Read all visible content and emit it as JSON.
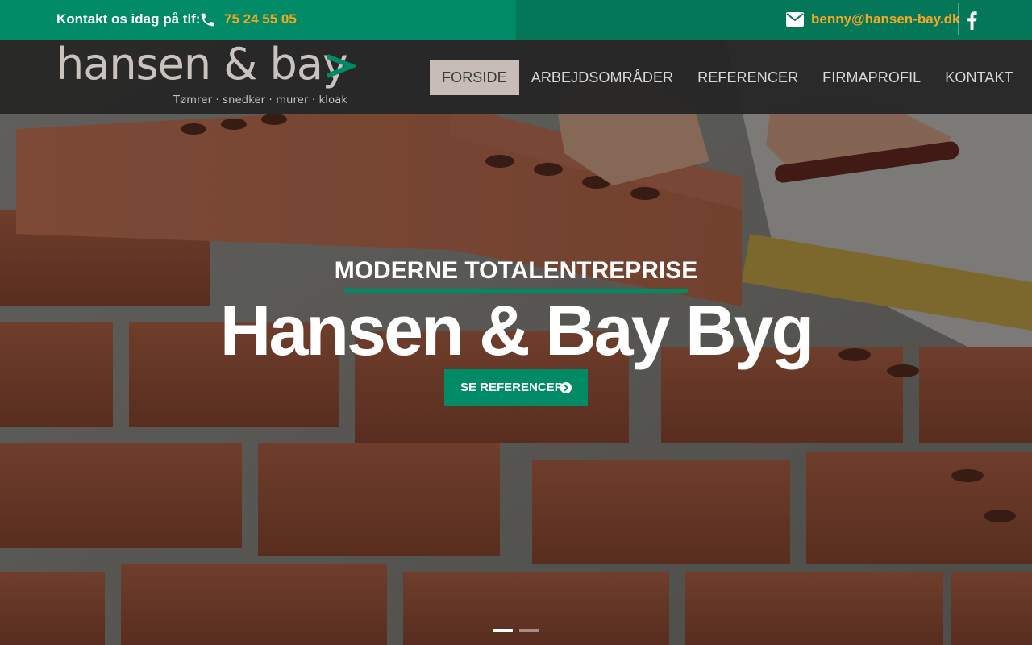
{
  "topbar": {
    "contact_label": "Kontakt os idag på tlf:",
    "phone": "75 24 55 05",
    "email": "benny@hansen-bay.dk",
    "icons": {
      "phone": "phone-icon",
      "mail": "envelope-icon",
      "social": "facebook-icon"
    }
  },
  "logo": {
    "wordmark": "hansen & bay",
    "tagline": "Tømrer · snedker · murer · kloak"
  },
  "nav": {
    "items": [
      {
        "label": "FORSIDE",
        "active": true
      },
      {
        "label": "ARBEJDSOMRÅDER",
        "active": false
      },
      {
        "label": "REFERENCER",
        "active": false
      },
      {
        "label": "FIRMAPROFIL",
        "active": false
      },
      {
        "label": "KONTAKT",
        "active": false
      }
    ]
  },
  "hero": {
    "subtitle": "MODERNE TOTALENTREPRISE",
    "title": "Hansen & Bay Byg",
    "button_label": "SE REFERENCER",
    "button_icon": "chevron-circle-right-icon",
    "slides": {
      "total": 2,
      "active": 1
    }
  },
  "colors": {
    "brand_green": "#018a66",
    "brand_green_dark": "#037758",
    "accent_orange": "#f5a623",
    "nav_active_bg": "#c7bdb6",
    "header_bg": "#262626"
  }
}
